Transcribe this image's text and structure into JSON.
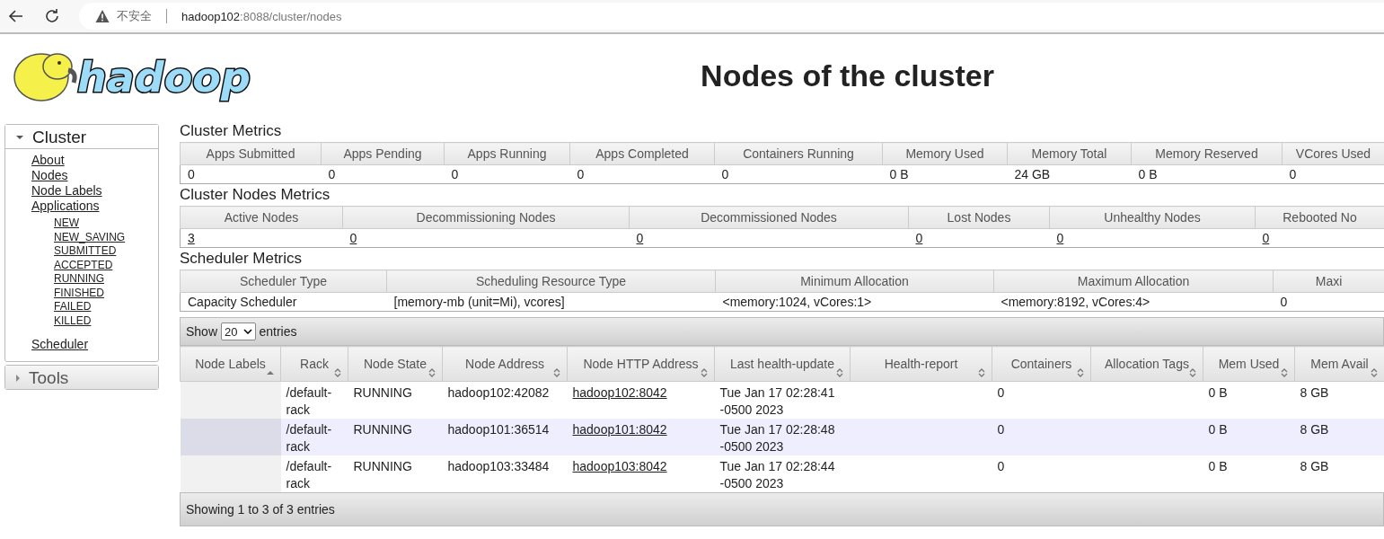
{
  "browser": {
    "security_label": "不安全",
    "url_host": "hadoop102",
    "url_rest": ":8088/cluster/nodes"
  },
  "logo": {
    "text": "hadoop"
  },
  "page_title": "Nodes of the cluster",
  "sidebar": [
    {
      "title": "Cluster",
      "expanded": true,
      "items": [
        {
          "label": "About"
        },
        {
          "label": "Nodes"
        },
        {
          "label": "Node Labels"
        },
        {
          "label": "Applications",
          "children": [
            {
              "label": "NEW"
            },
            {
              "label": "NEW_SAVING"
            },
            {
              "label": "SUBMITTED"
            },
            {
              "label": "ACCEPTED"
            },
            {
              "label": "RUNNING"
            },
            {
              "label": "FINISHED"
            },
            {
              "label": "FAILED"
            },
            {
              "label": "KILLED"
            }
          ]
        },
        {
          "label": "Scheduler"
        }
      ]
    },
    {
      "title": "Tools",
      "expanded": false
    }
  ],
  "metrics": [
    {
      "title": "Cluster Metrics",
      "columns": [
        "Apps Submitted",
        "Apps Pending",
        "Apps Running",
        "Apps Completed",
        "Containers Running",
        "Memory Used",
        "Memory Total",
        "Memory Reserved",
        "VCores Used"
      ],
      "values": [
        {
          "text": "0",
          "link": false
        },
        {
          "text": "0",
          "link": false
        },
        {
          "text": "0",
          "link": false
        },
        {
          "text": "0",
          "link": false
        },
        {
          "text": "0",
          "link": false
        },
        {
          "text": "0 B",
          "link": false
        },
        {
          "text": "24 GB",
          "link": false
        },
        {
          "text": "0 B",
          "link": false
        },
        {
          "text": "0",
          "link": false
        }
      ]
    },
    {
      "title": "Cluster Nodes Metrics",
      "columns": [
        "Active Nodes",
        "Decommissioning Nodes",
        "Decommissioned Nodes",
        "Lost Nodes",
        "Unhealthy Nodes",
        "Rebooted No"
      ],
      "values": [
        {
          "text": "3",
          "link": true
        },
        {
          "text": "0",
          "link": true
        },
        {
          "text": "0",
          "link": true
        },
        {
          "text": "0",
          "link": true
        },
        {
          "text": "0",
          "link": true
        },
        {
          "text": "0",
          "link": true
        }
      ]
    },
    {
      "title": "Scheduler Metrics",
      "columns": [
        "Scheduler Type",
        "Scheduling Resource Type",
        "Minimum Allocation",
        "Maximum Allocation",
        "Maxi"
      ],
      "values": [
        {
          "text": "Capacity Scheduler",
          "link": false
        },
        {
          "text": "[memory-mb (unit=Mi), vcores]",
          "link": false
        },
        {
          "text": "<memory:1024, vCores:1>",
          "link": false
        },
        {
          "text": "<memory:8192, vCores:4>",
          "link": false
        },
        {
          "text": "0",
          "link": false
        }
      ]
    }
  ],
  "nodes_table": {
    "show_label": "Show",
    "page_size": "20",
    "entries_label": "entries",
    "columns": [
      {
        "label": "Node Labels",
        "sorted_ascending": true
      },
      {
        "label": "Rack",
        "sorted_ascending": false
      },
      {
        "label": "Node State",
        "sorted_ascending": false
      },
      {
        "label": "Node Address",
        "sorted_ascending": false
      },
      {
        "label": "Node HTTP Address",
        "sorted_ascending": false
      },
      {
        "label": "Last health-update",
        "sorted_ascending": false
      },
      {
        "label": "Health-report",
        "sorted_ascending": false
      },
      {
        "label": "Containers",
        "sorted_ascending": false
      },
      {
        "label": "Allocation Tags",
        "sorted_ascending": false
      },
      {
        "label": "Mem Used",
        "sorted_ascending": false
      },
      {
        "label": "Mem Avail",
        "sorted_ascending": false
      }
    ],
    "rows": [
      [
        "",
        "/default-rack",
        "RUNNING",
        "hadoop102:42082",
        {
          "link": "hadoop102:8042"
        },
        "Tue Jan 17 02:28:41 -0500 2023",
        "",
        "0",
        "",
        "0 B",
        "8 GB"
      ],
      [
        "",
        "/default-rack",
        "RUNNING",
        "hadoop101:36514",
        {
          "link": "hadoop101:8042"
        },
        "Tue Jan 17 02:28:48 -0500 2023",
        "",
        "0",
        "",
        "0 B",
        "8 GB"
      ],
      [
        "",
        "/default-rack",
        "RUNNING",
        "hadoop103:33484",
        {
          "link": "hadoop103:8042"
        },
        "Tue Jan 17 02:28:44 -0500 2023",
        "",
        "0",
        "",
        "0 B",
        "8 GB"
      ]
    ],
    "info": "Showing 1 to 3 of 3 entries"
  }
}
